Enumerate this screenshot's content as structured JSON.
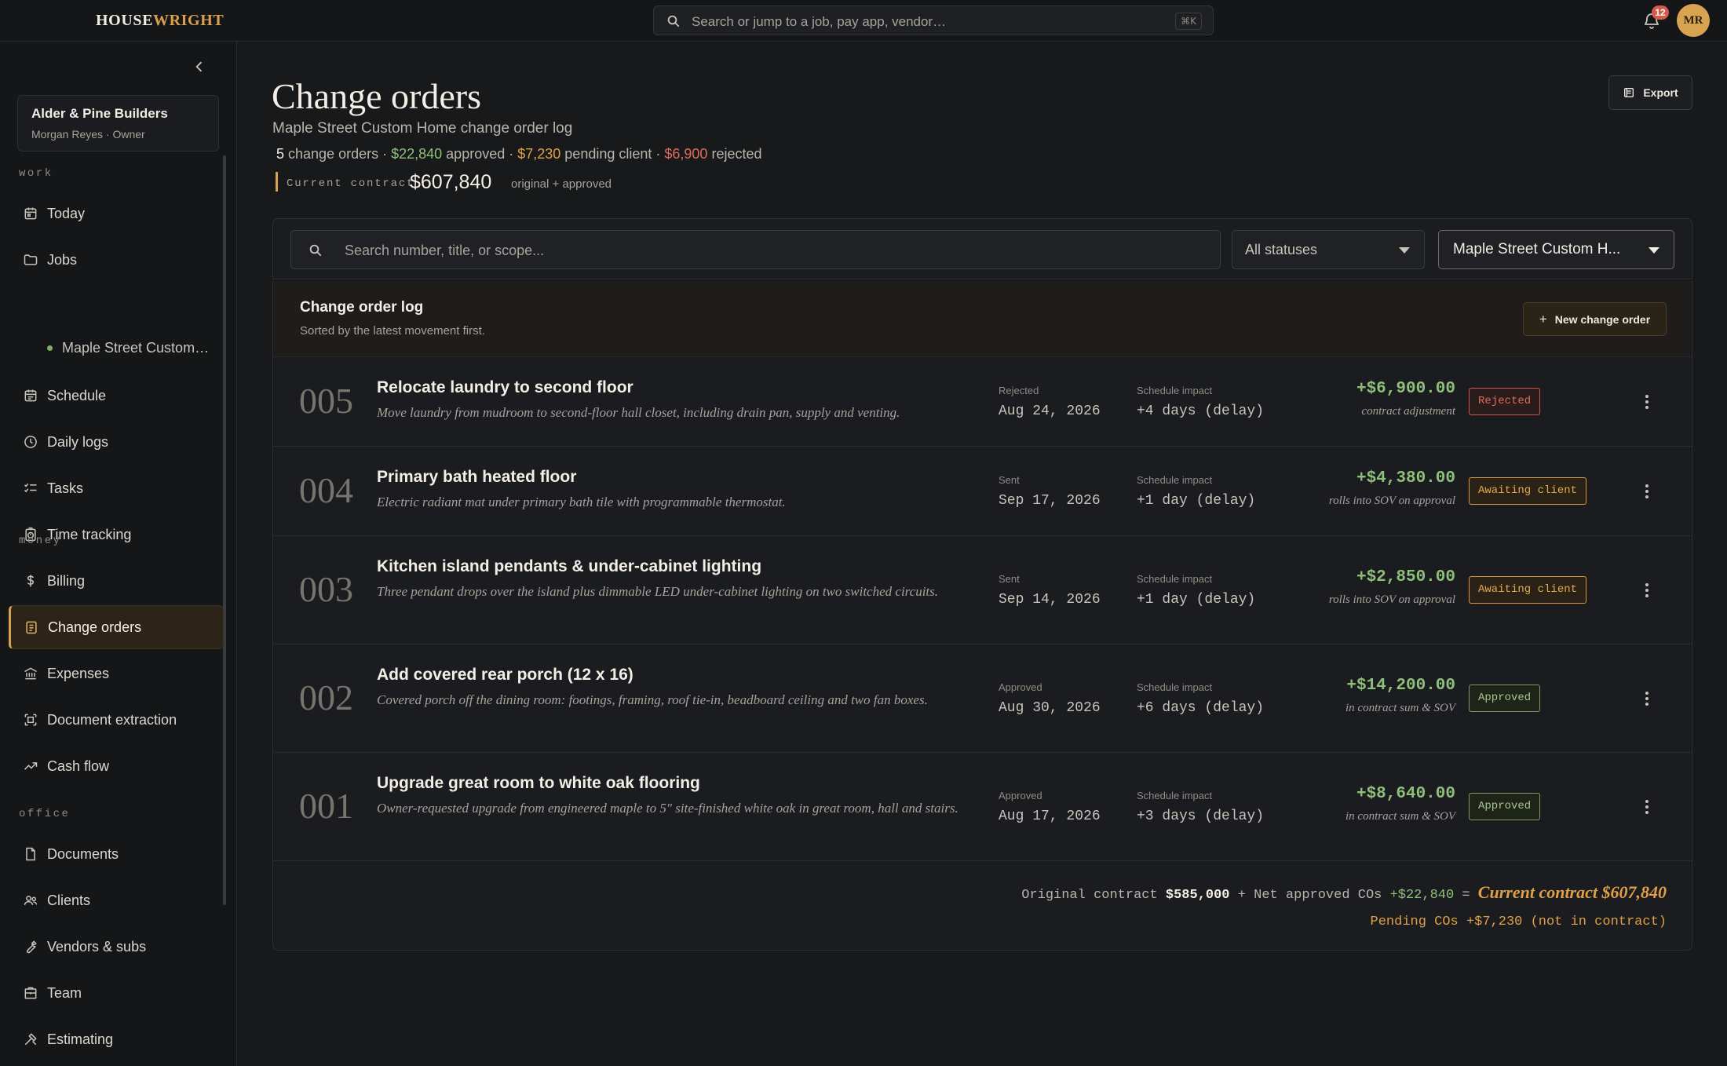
{
  "app": {
    "logo_part1": "HOUSE",
    "logo_part2": "WRIGHT",
    "search_placeholder": "Search or jump to a job, pay app, vendor…",
    "search_shortcut": "⌘K",
    "notification_count": "12",
    "avatar_initials": "MR",
    "accent_color": "#d8a24d"
  },
  "sidebar": {
    "org_name": "Alder & Pine Builders",
    "org_user": "Morgan Reyes · Owner",
    "sections": {
      "work": "work",
      "money": "money",
      "office": "office"
    },
    "items": {
      "today": "Today",
      "jobs": "Jobs",
      "job_sub": "Maple Street Custom…",
      "schedule": "Schedule",
      "daily_logs": "Daily logs",
      "tasks": "Tasks",
      "time_tracking": "Time tracking",
      "billing": "Billing",
      "change_orders": "Change orders",
      "expenses": "Expenses",
      "document_extraction": "Document extraction",
      "cash_flow": "Cash flow",
      "documents": "Documents",
      "clients": "Clients",
      "vendors": "Vendors & subs",
      "team": "Team",
      "estimating": "Estimating"
    },
    "active_item": "change_orders"
  },
  "header": {
    "title": "Change orders",
    "subtitle": "Maple Street Custom Home change order log",
    "summary": {
      "count": "5",
      "count_label": " change orders · ",
      "approved_amount": "$22,840",
      "approved_label": " approved · ",
      "pending_amount": "$7,230",
      "pending_label": " pending client · ",
      "rejected_amount": "$6,900",
      "rejected_label": " rejected"
    },
    "contract_label": "Current contract",
    "contract_value": "$607,840",
    "contract_note": "original + approved",
    "export_label": "Export"
  },
  "filters": {
    "search_placeholder": "Search number, title, or scope...",
    "status_value": "All statuses",
    "job_value": "Maple Street Custom H..."
  },
  "log": {
    "title": "Change order log",
    "subtitle": "Sorted by the latest movement first.",
    "new_button": "New change order",
    "impact_label": "Schedule impact",
    "rows": [
      {
        "number": "005",
        "title": "Relocate laundry to second floor",
        "description": "Move laundry from mudroom to second-floor hall closet, including drain pan, supply and venting.",
        "state": "Rejected",
        "date": "Aug 24, 2026",
        "impact": "+4 days (delay)",
        "amount": "+$6,900.00",
        "amount_note": "contract adjustment",
        "badge": "Rejected",
        "badge_type": "rejected"
      },
      {
        "number": "004",
        "title": "Primary bath heated floor",
        "description": "Electric radiant mat under primary bath tile with programmable thermostat.",
        "state": "Sent",
        "date": "Sep 17, 2026",
        "impact": "+1 day (delay)",
        "amount": "+$4,380.00",
        "amount_note": "rolls into SOV on approval",
        "badge": "Awaiting client",
        "badge_type": "awaiting"
      },
      {
        "number": "003",
        "title": "Kitchen island pendants & under-cabinet lighting",
        "description": "Three pendant drops over the island plus dimmable LED under-cabinet lighting on two switched circuits.",
        "state": "Sent",
        "date": "Sep 14, 2026",
        "impact": "+1 day (delay)",
        "amount": "+$2,850.00",
        "amount_note": "rolls into SOV on approval",
        "badge": "Awaiting client",
        "badge_type": "awaiting"
      },
      {
        "number": "002",
        "title": "Add covered rear porch (12 x 16)",
        "description": "Covered porch off the dining room: footings, framing, roof tie-in, beadboard ceiling and two fan boxes.",
        "state": "Approved",
        "date": "Aug 30, 2026",
        "impact": "+6 days (delay)",
        "amount": "+$14,200.00",
        "amount_note": "in contract sum & SOV",
        "badge": "Approved",
        "badge_type": "approved"
      },
      {
        "number": "001",
        "title": "Upgrade great room to white oak flooring",
        "description": "Owner-requested upgrade from engineered maple to 5\" site-finished white oak in great room, hall and stairs.",
        "state": "Approved",
        "date": "Aug 17, 2026",
        "impact": "+3 days (delay)",
        "amount": "+$8,640.00",
        "amount_note": "in contract sum & SOV",
        "badge": "Approved",
        "badge_type": "approved"
      }
    ],
    "footer": {
      "original_label": "Original contract ",
      "original_value": "$585,000",
      "net_label": " + Net approved COs ",
      "net_value": "+$22,840",
      "equals": " = ",
      "current": "Current contract $607,840",
      "pending": "Pending COs +$7,230 (not in contract)"
    }
  }
}
